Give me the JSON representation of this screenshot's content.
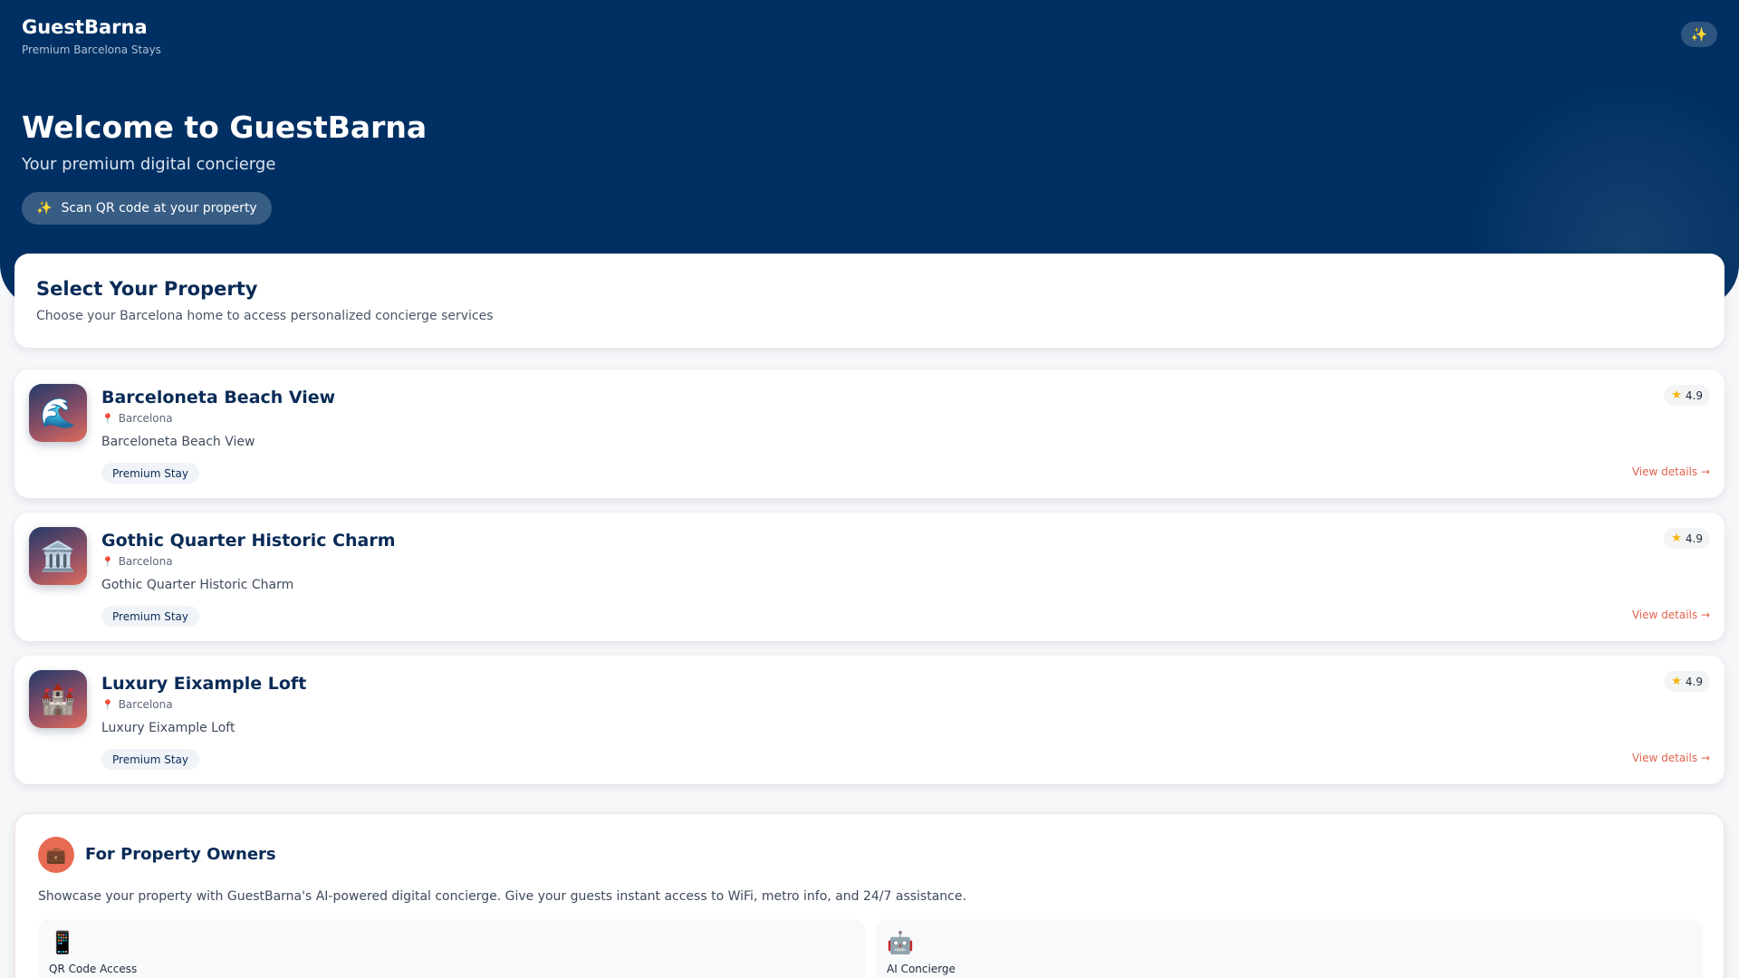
{
  "header": {
    "brand_name": "GuestBarna",
    "brand_tagline": "Premium Barcelona Stays",
    "action_icon": "sparkles-icon",
    "action_glyph": "✨"
  },
  "hero": {
    "title": "Welcome to GuestBarna",
    "subtitle": "Your premium digital concierge",
    "qr_icon": "✨",
    "qr_label": "Scan QR code at your property"
  },
  "select": {
    "title": "Select Your Property",
    "description": "Choose your Barcelona home to access personalized concierge services"
  },
  "properties": [
    {
      "icon": "wave-icon",
      "glyph": "🌊",
      "title": "Barceloneta Beach View",
      "location": "Barcelona",
      "description": "Barceloneta Beach View",
      "badge": "Premium Stay",
      "rating": "4.9",
      "link": "View details →"
    },
    {
      "icon": "classical-building-icon",
      "glyph": "🏛️",
      "title": "Gothic Quarter Historic Charm",
      "location": "Barcelona",
      "description": "Gothic Quarter Historic Charm",
      "badge": "Premium Stay",
      "rating": "4.9",
      "link": "View details →"
    },
    {
      "icon": "castle-icon",
      "glyph": "🏰",
      "title": "Luxury Eixample Loft",
      "location": "Barcelona",
      "description": "Luxury Eixample Loft",
      "badge": "Premium Stay",
      "rating": "4.9",
      "link": "View details →"
    }
  ],
  "owners": {
    "icon": "briefcase-icon",
    "glyph": "💼",
    "title": "For Property Owners",
    "description": "Showcase your property with GuestBarna's AI-powered digital concierge. Give your guests instant access to WiFi, metro info, and 24/7 assistance.",
    "features": [
      {
        "icon": "mobile-phone-icon",
        "glyph": "📱",
        "label": "QR Code Access"
      },
      {
        "icon": "robot-icon",
        "glyph": "🤖",
        "label": "AI Concierge"
      }
    ]
  },
  "colors": {
    "header_bg": "#003063",
    "accent": "#e0634e",
    "title": "#0a2b57",
    "star": "#f5b301"
  }
}
